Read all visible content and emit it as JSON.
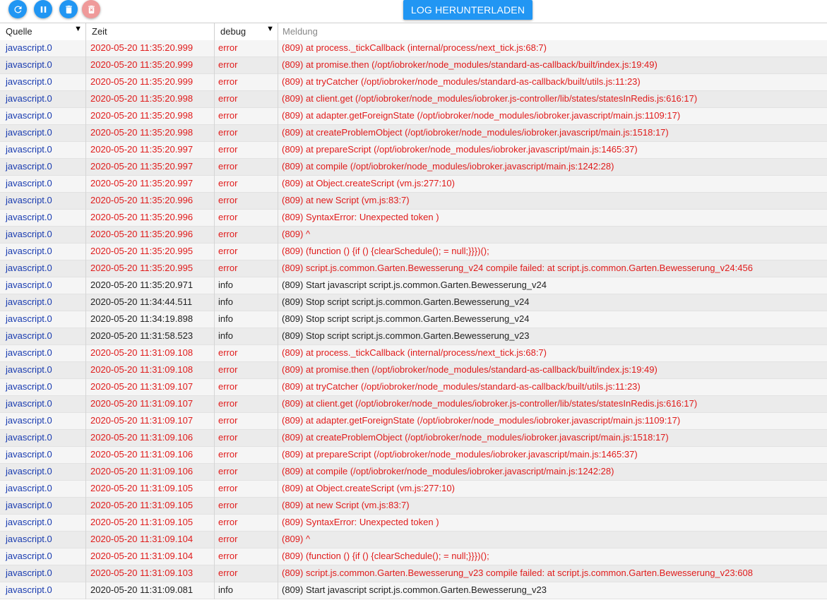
{
  "toolbar": {
    "download_label": "LOG HERUNTERLADEN",
    "buttons": [
      "refresh-icon",
      "pause-icon",
      "delete-icon",
      "delete-all-icon"
    ]
  },
  "header": {
    "source_label": "Quelle",
    "time_label": "Zeit",
    "severity_label": "debug",
    "message_placeholder": "Meldung"
  },
  "colors": {
    "accent": "#2196f3",
    "error": "#e01b1b",
    "source": "#1a3cb0",
    "disabled": "#ef9a9a"
  },
  "rows": [
    {
      "source": "javascript.0",
      "time": "2020-05-20 11:35:20.999",
      "severity": "error",
      "message": "(809) at process._tickCallback (internal/process/next_tick.js:68:7)"
    },
    {
      "source": "javascript.0",
      "time": "2020-05-20 11:35:20.999",
      "severity": "error",
      "message": "(809) at promise.then (/opt/iobroker/node_modules/standard-as-callback/built/index.js:19:49)"
    },
    {
      "source": "javascript.0",
      "time": "2020-05-20 11:35:20.999",
      "severity": "error",
      "message": "(809) at tryCatcher (/opt/iobroker/node_modules/standard-as-callback/built/utils.js:11:23)"
    },
    {
      "source": "javascript.0",
      "time": "2020-05-20 11:35:20.998",
      "severity": "error",
      "message": "(809) at client.get (/opt/iobroker/node_modules/iobroker.js-controller/lib/states/statesInRedis.js:616:17)"
    },
    {
      "source": "javascript.0",
      "time": "2020-05-20 11:35:20.998",
      "severity": "error",
      "message": "(809) at adapter.getForeignState (/opt/iobroker/node_modules/iobroker.javascript/main.js:1109:17)"
    },
    {
      "source": "javascript.0",
      "time": "2020-05-20 11:35:20.998",
      "severity": "error",
      "message": "(809) at createProblemObject (/opt/iobroker/node_modules/iobroker.javascript/main.js:1518:17)"
    },
    {
      "source": "javascript.0",
      "time": "2020-05-20 11:35:20.997",
      "severity": "error",
      "message": "(809) at prepareScript (/opt/iobroker/node_modules/iobroker.javascript/main.js:1465:37)"
    },
    {
      "source": "javascript.0",
      "time": "2020-05-20 11:35:20.997",
      "severity": "error",
      "message": "(809) at compile (/opt/iobroker/node_modules/iobroker.javascript/main.js:1242:28)"
    },
    {
      "source": "javascript.0",
      "time": "2020-05-20 11:35:20.997",
      "severity": "error",
      "message": "(809) at Object.createScript (vm.js:277:10)"
    },
    {
      "source": "javascript.0",
      "time": "2020-05-20 11:35:20.996",
      "severity": "error",
      "message": "(809) at new Script (vm.js:83:7)"
    },
    {
      "source": "javascript.0",
      "time": "2020-05-20 11:35:20.996",
      "severity": "error",
      "message": "(809) SyntaxError: Unexpected token )"
    },
    {
      "source": "javascript.0",
      "time": "2020-05-20 11:35:20.996",
      "severity": "error",
      "message": "(809) ^"
    },
    {
      "source": "javascript.0",
      "time": "2020-05-20 11:35:20.995",
      "severity": "error",
      "message": "(809) (function () {if () {clearSchedule(); = null;}}})();"
    },
    {
      "source": "javascript.0",
      "time": "2020-05-20 11:35:20.995",
      "severity": "error",
      "message": "(809) script.js.common.Garten.Bewesserung_v24 compile failed: at script.js.common.Garten.Bewesserung_v24:456"
    },
    {
      "source": "javascript.0",
      "time": "2020-05-20 11:35:20.971",
      "severity": "info",
      "message": "(809) Start javascript script.js.common.Garten.Bewesserung_v24"
    },
    {
      "source": "javascript.0",
      "time": "2020-05-20 11:34:44.511",
      "severity": "info",
      "message": "(809) Stop script script.js.common.Garten.Bewesserung_v24"
    },
    {
      "source": "javascript.0",
      "time": "2020-05-20 11:34:19.898",
      "severity": "info",
      "message": "(809) Stop script script.js.common.Garten.Bewesserung_v24"
    },
    {
      "source": "javascript.0",
      "time": "2020-05-20 11:31:58.523",
      "severity": "info",
      "message": "(809) Stop script script.js.common.Garten.Bewesserung_v23"
    },
    {
      "source": "javascript.0",
      "time": "2020-05-20 11:31:09.108",
      "severity": "error",
      "message": "(809) at process._tickCallback (internal/process/next_tick.js:68:7)"
    },
    {
      "source": "javascript.0",
      "time": "2020-05-20 11:31:09.108",
      "severity": "error",
      "message": "(809) at promise.then (/opt/iobroker/node_modules/standard-as-callback/built/index.js:19:49)"
    },
    {
      "source": "javascript.0",
      "time": "2020-05-20 11:31:09.107",
      "severity": "error",
      "message": "(809) at tryCatcher (/opt/iobroker/node_modules/standard-as-callback/built/utils.js:11:23)"
    },
    {
      "source": "javascript.0",
      "time": "2020-05-20 11:31:09.107",
      "severity": "error",
      "message": "(809) at client.get (/opt/iobroker/node_modules/iobroker.js-controller/lib/states/statesInRedis.js:616:17)"
    },
    {
      "source": "javascript.0",
      "time": "2020-05-20 11:31:09.107",
      "severity": "error",
      "message": "(809) at adapter.getForeignState (/opt/iobroker/node_modules/iobroker.javascript/main.js:1109:17)"
    },
    {
      "source": "javascript.0",
      "time": "2020-05-20 11:31:09.106",
      "severity": "error",
      "message": "(809) at createProblemObject (/opt/iobroker/node_modules/iobroker.javascript/main.js:1518:17)"
    },
    {
      "source": "javascript.0",
      "time": "2020-05-20 11:31:09.106",
      "severity": "error",
      "message": "(809) at prepareScript (/opt/iobroker/node_modules/iobroker.javascript/main.js:1465:37)"
    },
    {
      "source": "javascript.0",
      "time": "2020-05-20 11:31:09.106",
      "severity": "error",
      "message": "(809) at compile (/opt/iobroker/node_modules/iobroker.javascript/main.js:1242:28)"
    },
    {
      "source": "javascript.0",
      "time": "2020-05-20 11:31:09.105",
      "severity": "error",
      "message": "(809) at Object.createScript (vm.js:277:10)"
    },
    {
      "source": "javascript.0",
      "time": "2020-05-20 11:31:09.105",
      "severity": "error",
      "message": "(809) at new Script (vm.js:83:7)"
    },
    {
      "source": "javascript.0",
      "time": "2020-05-20 11:31:09.105",
      "severity": "error",
      "message": "(809) SyntaxError: Unexpected token )"
    },
    {
      "source": "javascript.0",
      "time": "2020-05-20 11:31:09.104",
      "severity": "error",
      "message": "(809) ^"
    },
    {
      "source": "javascript.0",
      "time": "2020-05-20 11:31:09.104",
      "severity": "error",
      "message": "(809) (function () {if () {clearSchedule(); = null;}}})();"
    },
    {
      "source": "javascript.0",
      "time": "2020-05-20 11:31:09.103",
      "severity": "error",
      "message": "(809) script.js.common.Garten.Bewesserung_v23 compile failed: at script.js.common.Garten.Bewesserung_v23:608"
    },
    {
      "source": "javascript.0",
      "time": "2020-05-20 11:31:09.081",
      "severity": "info",
      "message": "(809) Start javascript script.js.common.Garten.Bewesserung_v23"
    }
  ]
}
